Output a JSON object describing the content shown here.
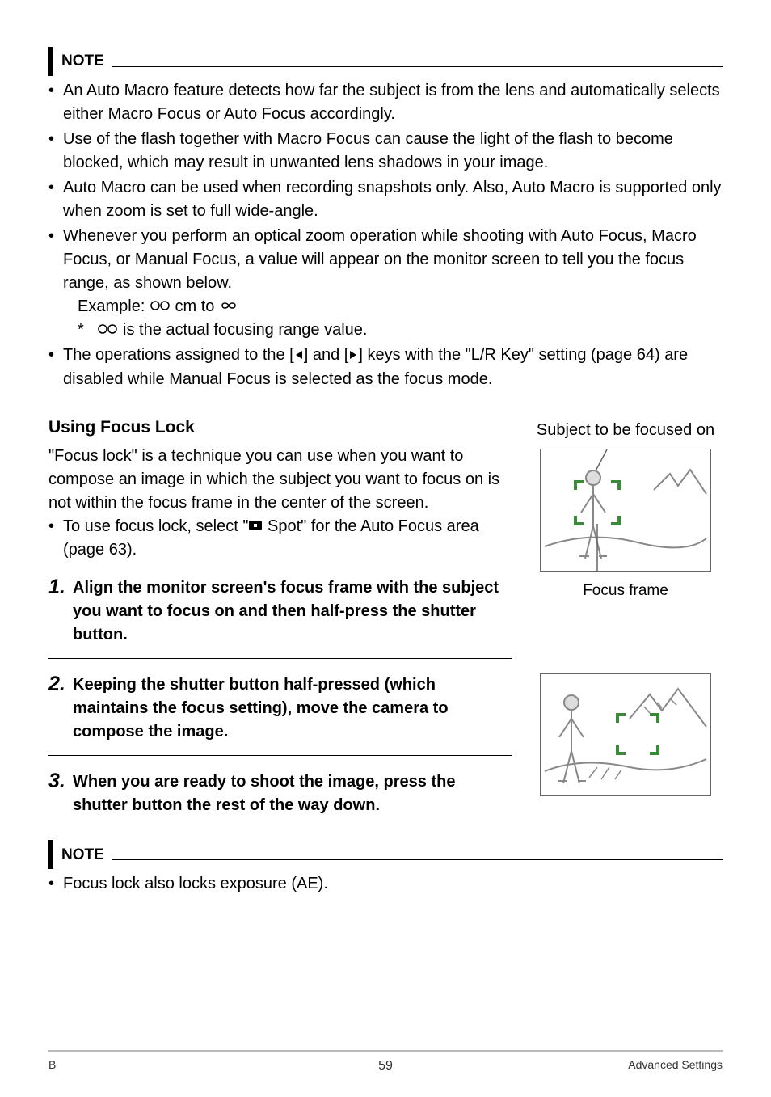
{
  "note_label": "NOTE",
  "note1": {
    "b1": "An Auto Macro feature detects how far the subject is from the lens and automatically selects either Macro Focus or Auto Focus accordingly.",
    "b2": "Use of the flash together with Macro Focus can cause the light of the flash to become blocked, which may result in unwanted lens shadows in your image.",
    "b3": "Auto Macro can be used when recording snapshots only. Also, Auto Macro is supported only when zoom is set to full wide-angle.",
    "b4": "Whenever you perform an optical zoom operation while shooting with Auto Focus, Macro Focus, or Manual Focus, a value will appear on the monitor screen to tell you the focus range, as shown below.",
    "example_pre": "Example: ",
    "example_mid": " cm to ",
    "asterisk_post": " is the actual focusing range value.",
    "b5_pre": "The operations assigned to the [",
    "b5_mid": "] and [",
    "b5_post": "] keys with the \"L/R Key\" setting (page 64) are disabled while Manual Focus is selected as the focus mode."
  },
  "section_title": "Using Focus Lock",
  "section_body": "\"Focus lock\" is a technique you can use when you want to compose an image in which the subject you want to focus on is not within the focus frame in the center of the screen.",
  "section_bullet_pre": "To use focus lock, select \"",
  "section_bullet_post": " Spot\" for the Auto Focus area (page 63).",
  "step1": "Align the monitor screen's focus frame with the subject you want to focus on and then half-press the shutter button.",
  "step2": "Keeping the shutter button half-pressed (which maintains the focus setting), move the camera to compose the image.",
  "step3": "When you are ready to shoot the image, press the shutter button the rest of the way down.",
  "note2_b1": "Focus lock also locks exposure (AE).",
  "label_subject": "Subject to be focused on",
  "label_frame": "Focus frame",
  "footer_left": "B",
  "page_number": "59",
  "footer_right": "Advanced Settings",
  "step_nums": {
    "s1": "1.",
    "s2": "2.",
    "s3": "3."
  },
  "asterisk": "*"
}
